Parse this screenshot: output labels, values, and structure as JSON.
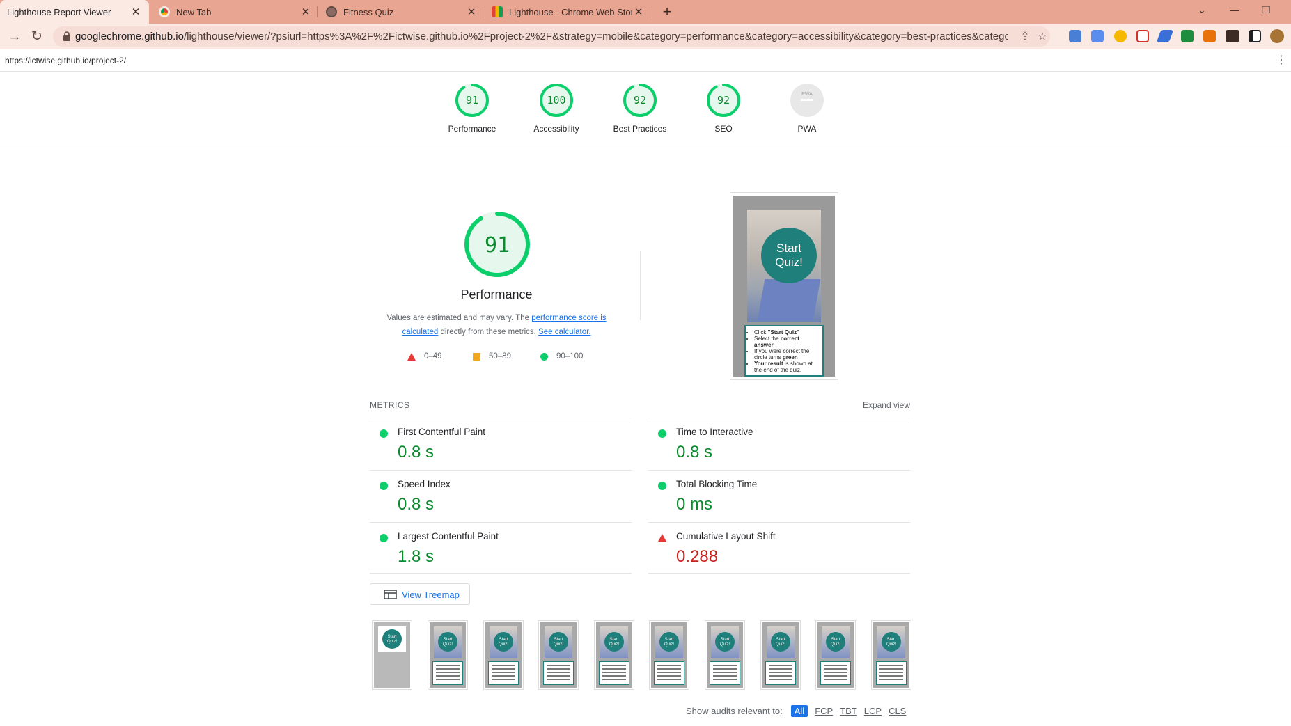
{
  "browser": {
    "tabs": [
      {
        "title": "Lighthouse Report Viewer",
        "active": true
      },
      {
        "title": "New Tab",
        "active": false
      },
      {
        "title": "Fitness Quiz",
        "active": false
      },
      {
        "title": "Lighthouse - Chrome Web Store",
        "active": false
      }
    ],
    "new_tab_label": "+",
    "address": {
      "host": "googlechrome.github.io",
      "path": "/lighthouse/viewer/?psiurl=https%3A%2F%2Fictwise.github.io%2Fproject-2%2F&strategy=mobile&category=performance&category=accessibility&category=best-practices&category=seo&ca..."
    }
  },
  "report": {
    "page_url": "https://ictwise.github.io/project-2/",
    "categories": [
      {
        "label": "Performance",
        "score": "91",
        "value": 91
      },
      {
        "label": "Accessibility",
        "score": "100",
        "value": 100
      },
      {
        "label": "Best Practices",
        "score": "92",
        "value": 92
      },
      {
        "label": "SEO",
        "score": "92",
        "value": 92
      },
      {
        "label": "PWA",
        "score": "PWA",
        "value": null
      }
    ],
    "performance": {
      "score": "91",
      "title": "Performance",
      "desc_prefix": "Values are estimated and may vary. The ",
      "desc_link1": "performance score is calculated",
      "desc_middle": " directly from these metrics. ",
      "desc_link2": "See calculator.",
      "legend": [
        {
          "range": "0–49",
          "shape": "triangle",
          "color": "#e53935"
        },
        {
          "range": "50–89",
          "shape": "square",
          "color": "#f4a623"
        },
        {
          "range": "90–100",
          "shape": "circle",
          "color": "#0cce6b"
        }
      ]
    },
    "screenshot": {
      "button": "Start Quiz!",
      "instructions": [
        {
          "pre": "Click ",
          "bold": "\"Start Quiz\"",
          "post": ""
        },
        {
          "pre": "Select the ",
          "bold": "correct answer",
          "post": ""
        },
        {
          "pre": "If you were correct the circle turns ",
          "bold": "green",
          "post": ""
        },
        {
          "pre": "",
          "bold": "Your result",
          "post": " is shown at the end of the quiz."
        }
      ]
    },
    "metrics_title": "METRICS",
    "expand_label": "Expand view",
    "metrics": [
      {
        "name": "First Contentful Paint",
        "value": "0.8 s",
        "status": "pass"
      },
      {
        "name": "Time to Interactive",
        "value": "0.8 s",
        "status": "pass"
      },
      {
        "name": "Speed Index",
        "value": "0.8 s",
        "status": "pass"
      },
      {
        "name": "Total Blocking Time",
        "value": "0 ms",
        "status": "pass"
      },
      {
        "name": "Largest Contentful Paint",
        "value": "1.8 s",
        "status": "pass"
      },
      {
        "name": "Cumulative Layout Shift",
        "value": "0.288",
        "status": "fail"
      }
    ],
    "treemap_label": "View Treemap",
    "filmstrip_frame_label": "Start Quiz!",
    "audit_filter": {
      "label": "Show audits relevant to:",
      "options": [
        "All",
        "FCP",
        "TBT",
        "LCP",
        "CLS"
      ],
      "selected": "All"
    }
  },
  "colors": {
    "pass": "#0cce6b",
    "fail": "#e53935",
    "teal": "#1f7f7a",
    "tabbar": "#e8a592",
    "link": "#1a73e8"
  }
}
